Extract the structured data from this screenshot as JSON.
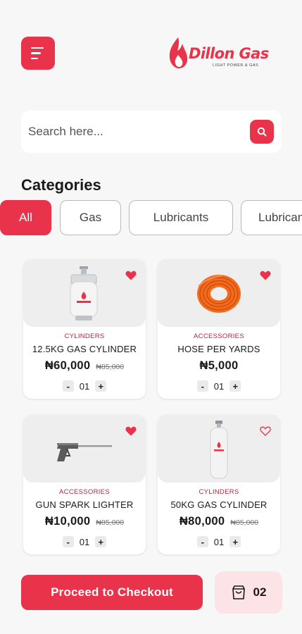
{
  "header": {
    "logo_text": "Dillon Gas",
    "logo_tagline": "LIGHT POWER & GAS",
    "menu_icon": "hamburger-menu-icon"
  },
  "search": {
    "placeholder": "Search here...",
    "value": "",
    "icon": "search-icon"
  },
  "categories": {
    "title": "Categories",
    "chips": [
      "All",
      "Gas",
      "Lubricants",
      "Lubricants"
    ],
    "selected": "All"
  },
  "products": [
    {
      "category": "CYLINDERS",
      "name": "12.5KG GAS CYLINDER",
      "price": "₦60,000",
      "old_price": "₦85,000",
      "qty": "01",
      "favorited": true,
      "image": "small-gas-cylinder"
    },
    {
      "category": "ACCESSORIES",
      "name": "HOSE PER YARDS",
      "price": "₦5,000",
      "old_price": "",
      "qty": "01",
      "favorited": true,
      "image": "coiled-hose"
    },
    {
      "category": "ACCESSORIES",
      "name": "GUN SPARK LIGHTER",
      "price": "₦10,000",
      "old_price": "₦85,000",
      "qty": "01",
      "favorited": true,
      "image": "spark-lighter-gun"
    },
    {
      "category": "CYLINDERS",
      "name": "50KG GAS CYLINDER",
      "price": "₦80,000",
      "old_price": "₦85,000",
      "qty": "01",
      "favorited": false,
      "image": "tall-gas-cylinder"
    }
  ],
  "qty_controls": {
    "minus": "-",
    "plus": "+"
  },
  "footer": {
    "checkout_label": "Proceed to Checkout",
    "cart_count": "02",
    "cart_icon": "shopping-bag-icon"
  },
  "colors": {
    "accent": "#e8334a",
    "category_text": "#b0283a",
    "cart_bg": "#fbe3e6",
    "hose": "#f26a1b"
  }
}
